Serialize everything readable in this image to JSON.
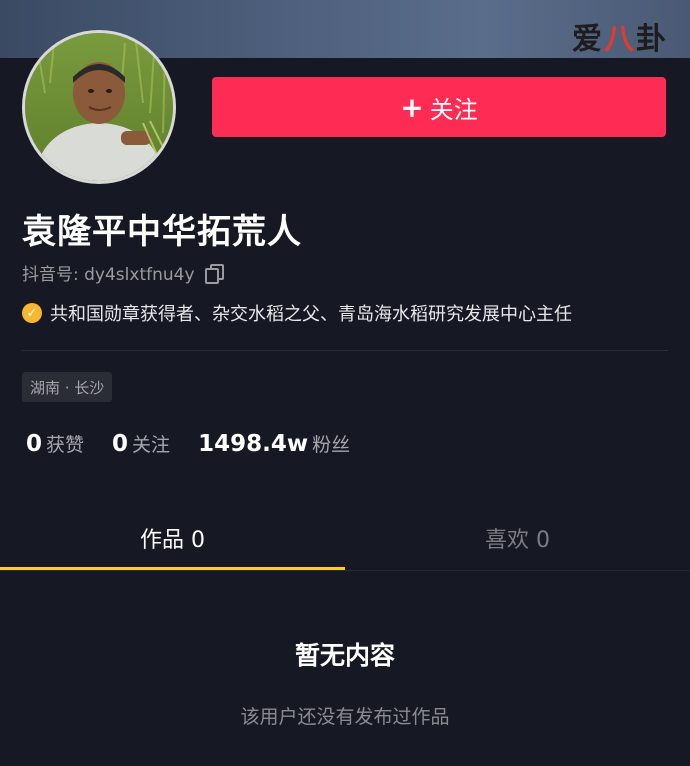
{
  "watermark": {
    "part1": "爱",
    "part2": "八",
    "part3": "卦"
  },
  "profile": {
    "follow_plus": "+",
    "follow_label": "关注",
    "username": "袁隆平中华拓荒人",
    "douyin_id": "抖音号: dy4slxtfnu4y",
    "verify_icon": "check-icon",
    "verification": "共和国勋章获得者、杂交水稻之父、青岛海水稻研究发展中心主任",
    "location": "湖南 · 长沙"
  },
  "stats": [
    {
      "num": "0",
      "label": "获赞"
    },
    {
      "num": "0",
      "label": "关注"
    },
    {
      "num": "1498.4w",
      "label": "粉丝"
    }
  ],
  "tabs": [
    {
      "label": "作品 0",
      "active": true
    },
    {
      "label": "喜欢 0",
      "active": false
    }
  ],
  "empty": {
    "title": "暂无内容",
    "subtitle": "该用户还没有发布过作品"
  },
  "colors": {
    "background": "#161823",
    "follow_button": "#fe2c55",
    "tab_indicator": "#facd2e",
    "verify_badge": "#f7b731"
  }
}
